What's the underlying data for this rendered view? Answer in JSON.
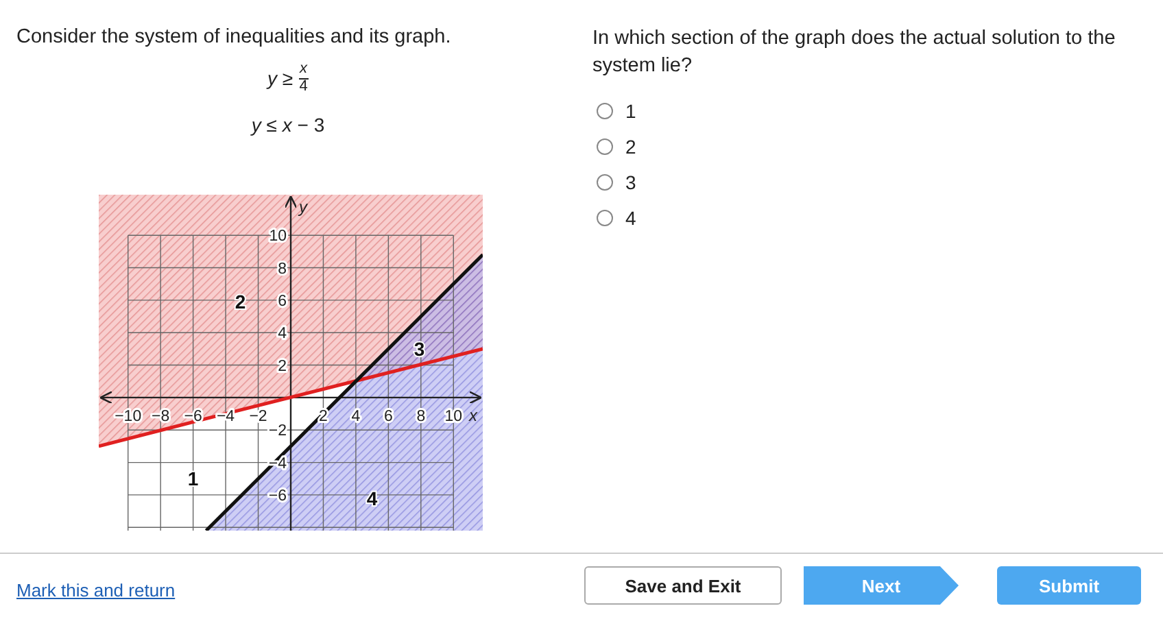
{
  "question": {
    "intro": "Consider the system of inequalities and its graph.",
    "equations": [
      {
        "kind": "fraction",
        "lhs": "y ≥",
        "numerator": "x",
        "denominator": "4"
      },
      {
        "kind": "plain",
        "text": "*y* ≤ *x* − 3"
      }
    ]
  },
  "graph": {
    "chart_data": {
      "type": "line",
      "xlabel": "x",
      "ylabel": "y",
      "x": [
        -11.8,
        -5.2,
        11.8
      ],
      "xlim": [
        -11.8,
        11.8
      ],
      "ylim": [
        -8.2,
        12.5
      ],
      "grid": true,
      "series": [
        {
          "color": "#e02020",
          "values": [
            -3,
            -1.3,
            3
          ]
        },
        {
          "color": "#111111",
          "values": [
            null,
            -8.2,
            8.8
          ]
        }
      ],
      "xticks": [
        {
          "value": -10,
          "label": "−10"
        },
        {
          "value": -8,
          "label": "−8"
        },
        {
          "value": -6,
          "label": "−6"
        },
        {
          "value": -4,
          "label": "−4"
        },
        {
          "value": -2,
          "label": "−2"
        },
        {
          "value": 2,
          "label": "2"
        },
        {
          "value": 4,
          "label": "4"
        },
        {
          "value": 6,
          "label": "6"
        },
        {
          "value": 8,
          "label": "8"
        },
        {
          "value": 10,
          "label": "10"
        }
      ],
      "yticks": [
        {
          "value": 10,
          "label": "10"
        },
        {
          "value": 8,
          "label": "8"
        },
        {
          "value": 6,
          "label": "6"
        },
        {
          "value": 4,
          "label": "4"
        },
        {
          "value": 2,
          "label": "2"
        },
        {
          "value": -2,
          "label": "−2"
        },
        {
          "value": -4,
          "label": "−4"
        },
        {
          "value": -6,
          "label": "−6"
        }
      ],
      "annotations": [
        "2",
        "3",
        "1",
        "4"
      ]
    }
  },
  "prompt": "In which section of the graph does the actual solution to the system lie?",
  "options": [
    {
      "label": "1",
      "selected": false
    },
    {
      "label": "2",
      "selected": false
    },
    {
      "label": "3",
      "selected": false
    },
    {
      "label": "4",
      "selected": false
    }
  ],
  "footer": {
    "link": "Mark this and return",
    "buttons": [
      {
        "label": "Save and Exit",
        "kind": "secondary"
      },
      {
        "label": "Next",
        "kind": "next"
      },
      {
        "label": "Submit",
        "kind": "primary"
      }
    ]
  }
}
